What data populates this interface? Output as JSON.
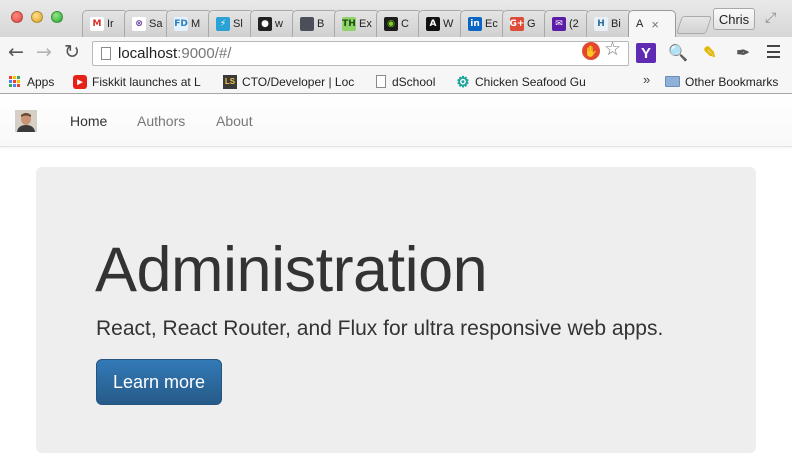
{
  "browser": {
    "tabs": [
      {
        "label": "Ir",
        "icon": "gmail-icon",
        "bg": "#ffffff",
        "glyph": "M",
        "fg": "#d93025"
      },
      {
        "label": "Sa",
        "icon": "sa-icon",
        "bg": "#ffffff",
        "glyph": "⊗",
        "fg": "#6b3fa0"
      },
      {
        "label": "M",
        "icon": "fd-icon",
        "bg": "#e6f2fb",
        "glyph": "FD",
        "fg": "#2a7fc1"
      },
      {
        "label": "Sl",
        "icon": "sl-icon",
        "bg": "#2aa2d6",
        "glyph": "⚡",
        "fg": "#ffffff"
      },
      {
        "label": "w",
        "icon": "github-icon",
        "bg": "#222222",
        "glyph": "●",
        "fg": "#ffffff"
      },
      {
        "label": "B",
        "icon": "b-icon",
        "bg": "#4a4f59",
        "glyph": "",
        "fg": "#ffffff"
      },
      {
        "label": "Ex",
        "icon": "th-icon",
        "bg": "#8fd46b",
        "glyph": "TH",
        "fg": "#1d4d0f"
      },
      {
        "label": "C",
        "icon": "c-icon",
        "bg": "#1c1c1c",
        "glyph": "◉",
        "fg": "#7ed321"
      },
      {
        "label": "W",
        "icon": "w-icon",
        "bg": "#111111",
        "glyph": "A",
        "fg": "#ffffff"
      },
      {
        "label": "Ec",
        "icon": "linkedin-icon",
        "bg": "#0a66c2",
        "glyph": "in",
        "fg": "#ffffff"
      },
      {
        "label": "G",
        "icon": "google-plus-icon",
        "bg": "#dd4b39",
        "glyph": "G+",
        "fg": "#ffffff"
      },
      {
        "label": "(2",
        "icon": "yahoo-mail-icon",
        "bg": "#5b1ca8",
        "glyph": "✉",
        "fg": "#ffffff"
      },
      {
        "label": "Bi",
        "icon": "h-icon",
        "bg": "#e9f1f7",
        "glyph": "H",
        "fg": "#2c6e9b"
      },
      {
        "label": "A",
        "icon": "",
        "bg": "",
        "glyph": "",
        "fg": ""
      }
    ],
    "profile_label": "Chris",
    "url_host": "localhost",
    "url_rest": ":9000/#/",
    "bookmarks": [
      {
        "label": "Apps",
        "icon": "apps-icon"
      },
      {
        "label": "Fiskkit launches at L",
        "icon": "youtube-icon"
      },
      {
        "label": "CTO/Developer | Loc",
        "icon": "ls-icon"
      },
      {
        "label": "dSchool",
        "icon": "document-icon"
      },
      {
        "label": "Chicken Seafood Gu",
        "icon": "gear-icon"
      }
    ],
    "other_bookmarks_label": "Other Bookmarks",
    "extensions": {
      "yahoo": "Y"
    }
  },
  "page": {
    "nav": {
      "home": "Home",
      "authors": "Authors",
      "about": "About"
    },
    "jumbotron": {
      "title": "Administration",
      "lead": "React, React Router, and Flux for ultra responsive web apps.",
      "button": "Learn more"
    }
  }
}
